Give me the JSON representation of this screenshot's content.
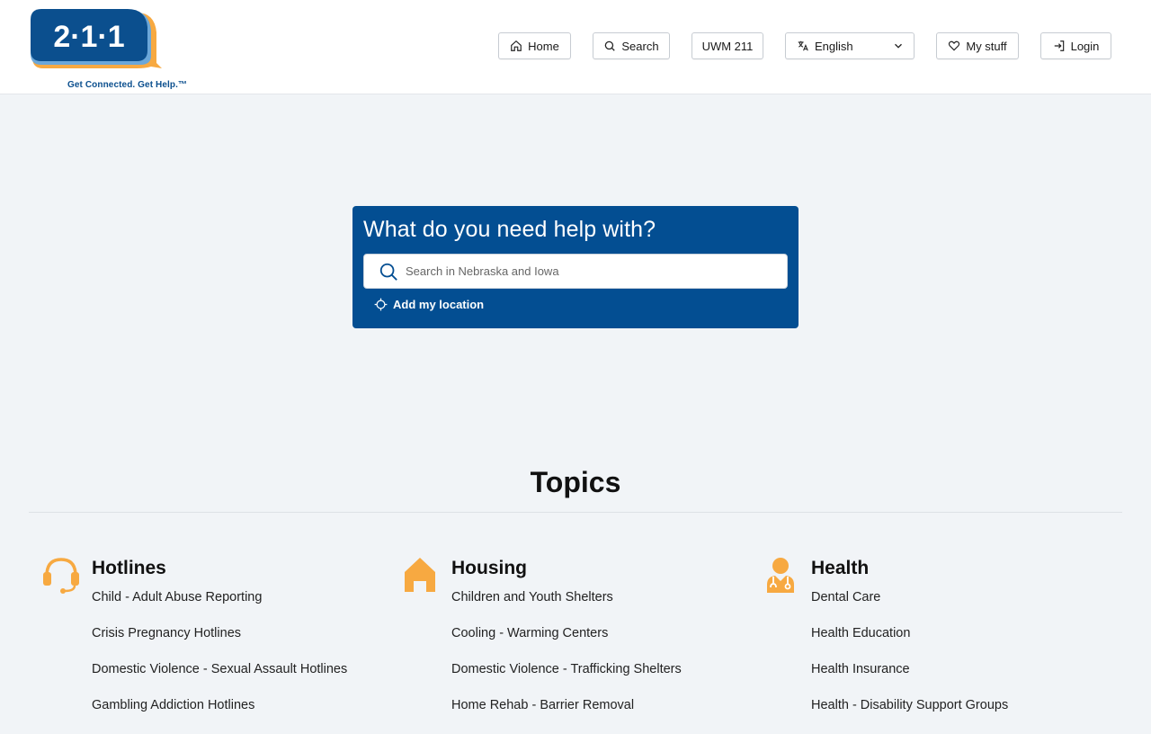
{
  "header": {
    "logo_number": "2·1·1",
    "logo_tagline": "Get Connected. Get Help.™",
    "nav": {
      "home": "Home",
      "search": "Search",
      "uwm": "UWM 211",
      "language": "English",
      "my_stuff": "My stuff",
      "login": "Login"
    }
  },
  "hero": {
    "title": "What do you need help with?",
    "search_placeholder": "Search in Nebraska and Iowa",
    "add_location": "Add my location"
  },
  "topics": {
    "title": "Topics",
    "columns": [
      {
        "name": "Hotlines",
        "icon": "headset-icon",
        "items": [
          "Child - Adult Abuse Reporting",
          "Crisis Pregnancy Hotlines",
          "Domestic Violence - Sexual Assault Hotlines",
          "Gambling Addiction Hotlines"
        ]
      },
      {
        "name": "Housing",
        "icon": "house-icon",
        "items": [
          "Children and Youth Shelters",
          "Cooling - Warming Centers",
          "Domestic Violence - Trafficking Shelters",
          "Home Rehab - Barrier Removal"
        ]
      },
      {
        "name": "Health",
        "icon": "doctor-icon",
        "items": [
          "Dental Care",
          "Health Education",
          "Health Insurance",
          "Health - Disability Support Groups"
        ]
      }
    ]
  },
  "colors": {
    "brand_blue": "#034e92",
    "accent_orange": "#f7a941",
    "background": "#f1f4f7"
  }
}
